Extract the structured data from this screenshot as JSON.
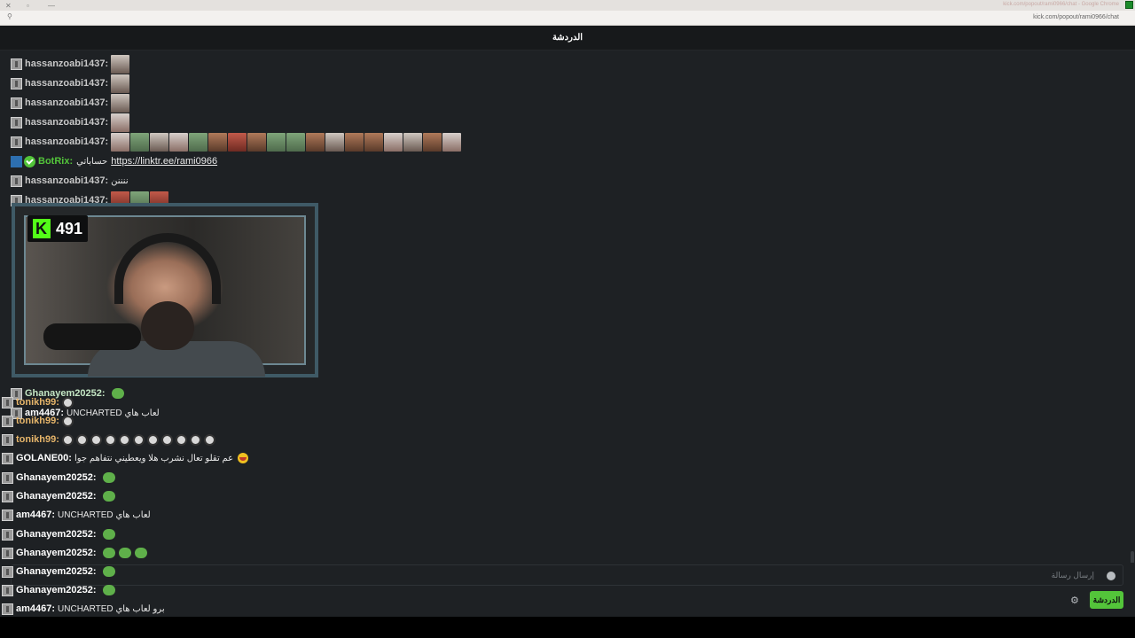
{
  "browser": {
    "title": "kick.com/popout/rami0966/chat - Google Chrome",
    "url": "kick.com/popout/rami0966/chat"
  },
  "header": {
    "title": "الدردشة"
  },
  "bot": {
    "name": "BotRix:",
    "text": "حساباتي",
    "link": "https://linktr.ee/rami0966"
  },
  "messages": {
    "m1": {
      "user": "hassanzoabi1437:"
    },
    "m2": {
      "user": "hassanzoabi1437:"
    },
    "m3": {
      "user": "hassanzoabi1437:"
    },
    "m4": {
      "user": "hassanzoabi1437:"
    },
    "m5": {
      "user": "hassanzoabi1437:"
    },
    "m7": {
      "user": "hassanzoabi1437:",
      "text": "ننننن"
    },
    "m8": {
      "user": "hassanzoabi1437:"
    },
    "c1": {
      "user": "Ghanayem20252:"
    },
    "c2": {
      "user": "tonikh99:"
    },
    "c3": {
      "user": "am4467:",
      "text": "UNCHARTED لعاب هاي"
    },
    "c4": {
      "user": "tonikh99:"
    },
    "c5": {
      "user": "tonikh99:"
    },
    "c6": {
      "user": "GOLANE00:",
      "text": "عم تقلو تعال نشرب هلا ويعطيني نتفاهم جوا"
    },
    "c7": {
      "user": "Ghanayem20252:"
    },
    "c8": {
      "user": "Ghanayem20252:"
    },
    "c9": {
      "user": "am4467:",
      "text": "UNCHARTED لعاب هاي"
    },
    "c10": {
      "user": "Ghanayem20252:"
    },
    "c11": {
      "user": "Ghanayem20252:"
    },
    "c12": {
      "user": "Ghanayem20252:"
    },
    "c13": {
      "user": "Ghanayem20252:"
    },
    "c14": {
      "user": "am4467:",
      "text": "UNCHARTED برو لعاب هاي"
    }
  },
  "webcam": {
    "viewer_count": "491"
  },
  "input": {
    "placeholder": "إرسال رسالة"
  },
  "buttons": {
    "chat": "الدردشة",
    "settings_icon": "gear-icon",
    "emoji_icon": "emoji-icon"
  },
  "colors": {
    "accent": "#53fc18",
    "send_button": "#53c43a",
    "background": "#1e2124"
  }
}
